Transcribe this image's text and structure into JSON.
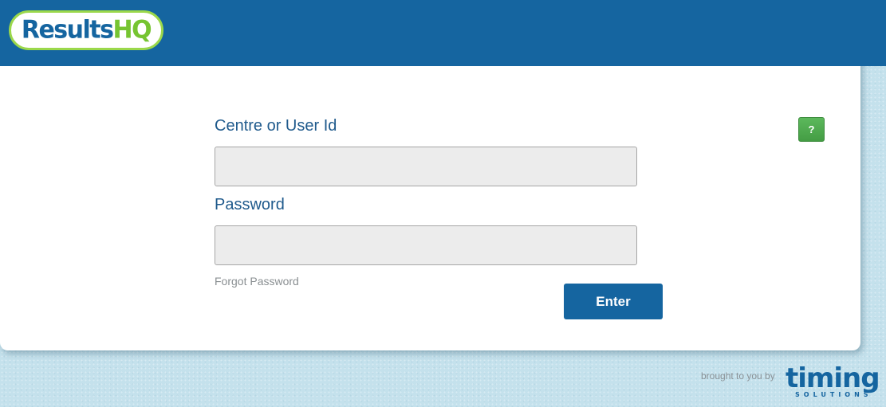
{
  "header": {
    "logo": {
      "text_primary": "Results",
      "text_accent": "HQ"
    }
  },
  "login": {
    "user_label": "Centre or User Id",
    "user_value": "",
    "password_label": "Password",
    "password_value": "",
    "forgot_label": "Forgot Password",
    "enter_label": "Enter",
    "help_label": "?"
  },
  "footer": {
    "credit_text": "brought to you by",
    "brand_logo": {
      "word": "timing",
      "subword": "SOLUTIONS"
    }
  },
  "colors": {
    "header_blue": "#1565a0",
    "logo_green": "#76c431",
    "help_green": "#5cb85c",
    "page_background": "#c4e1ec",
    "label_blue": "#1f5a8c",
    "input_fill": "#ececec"
  }
}
